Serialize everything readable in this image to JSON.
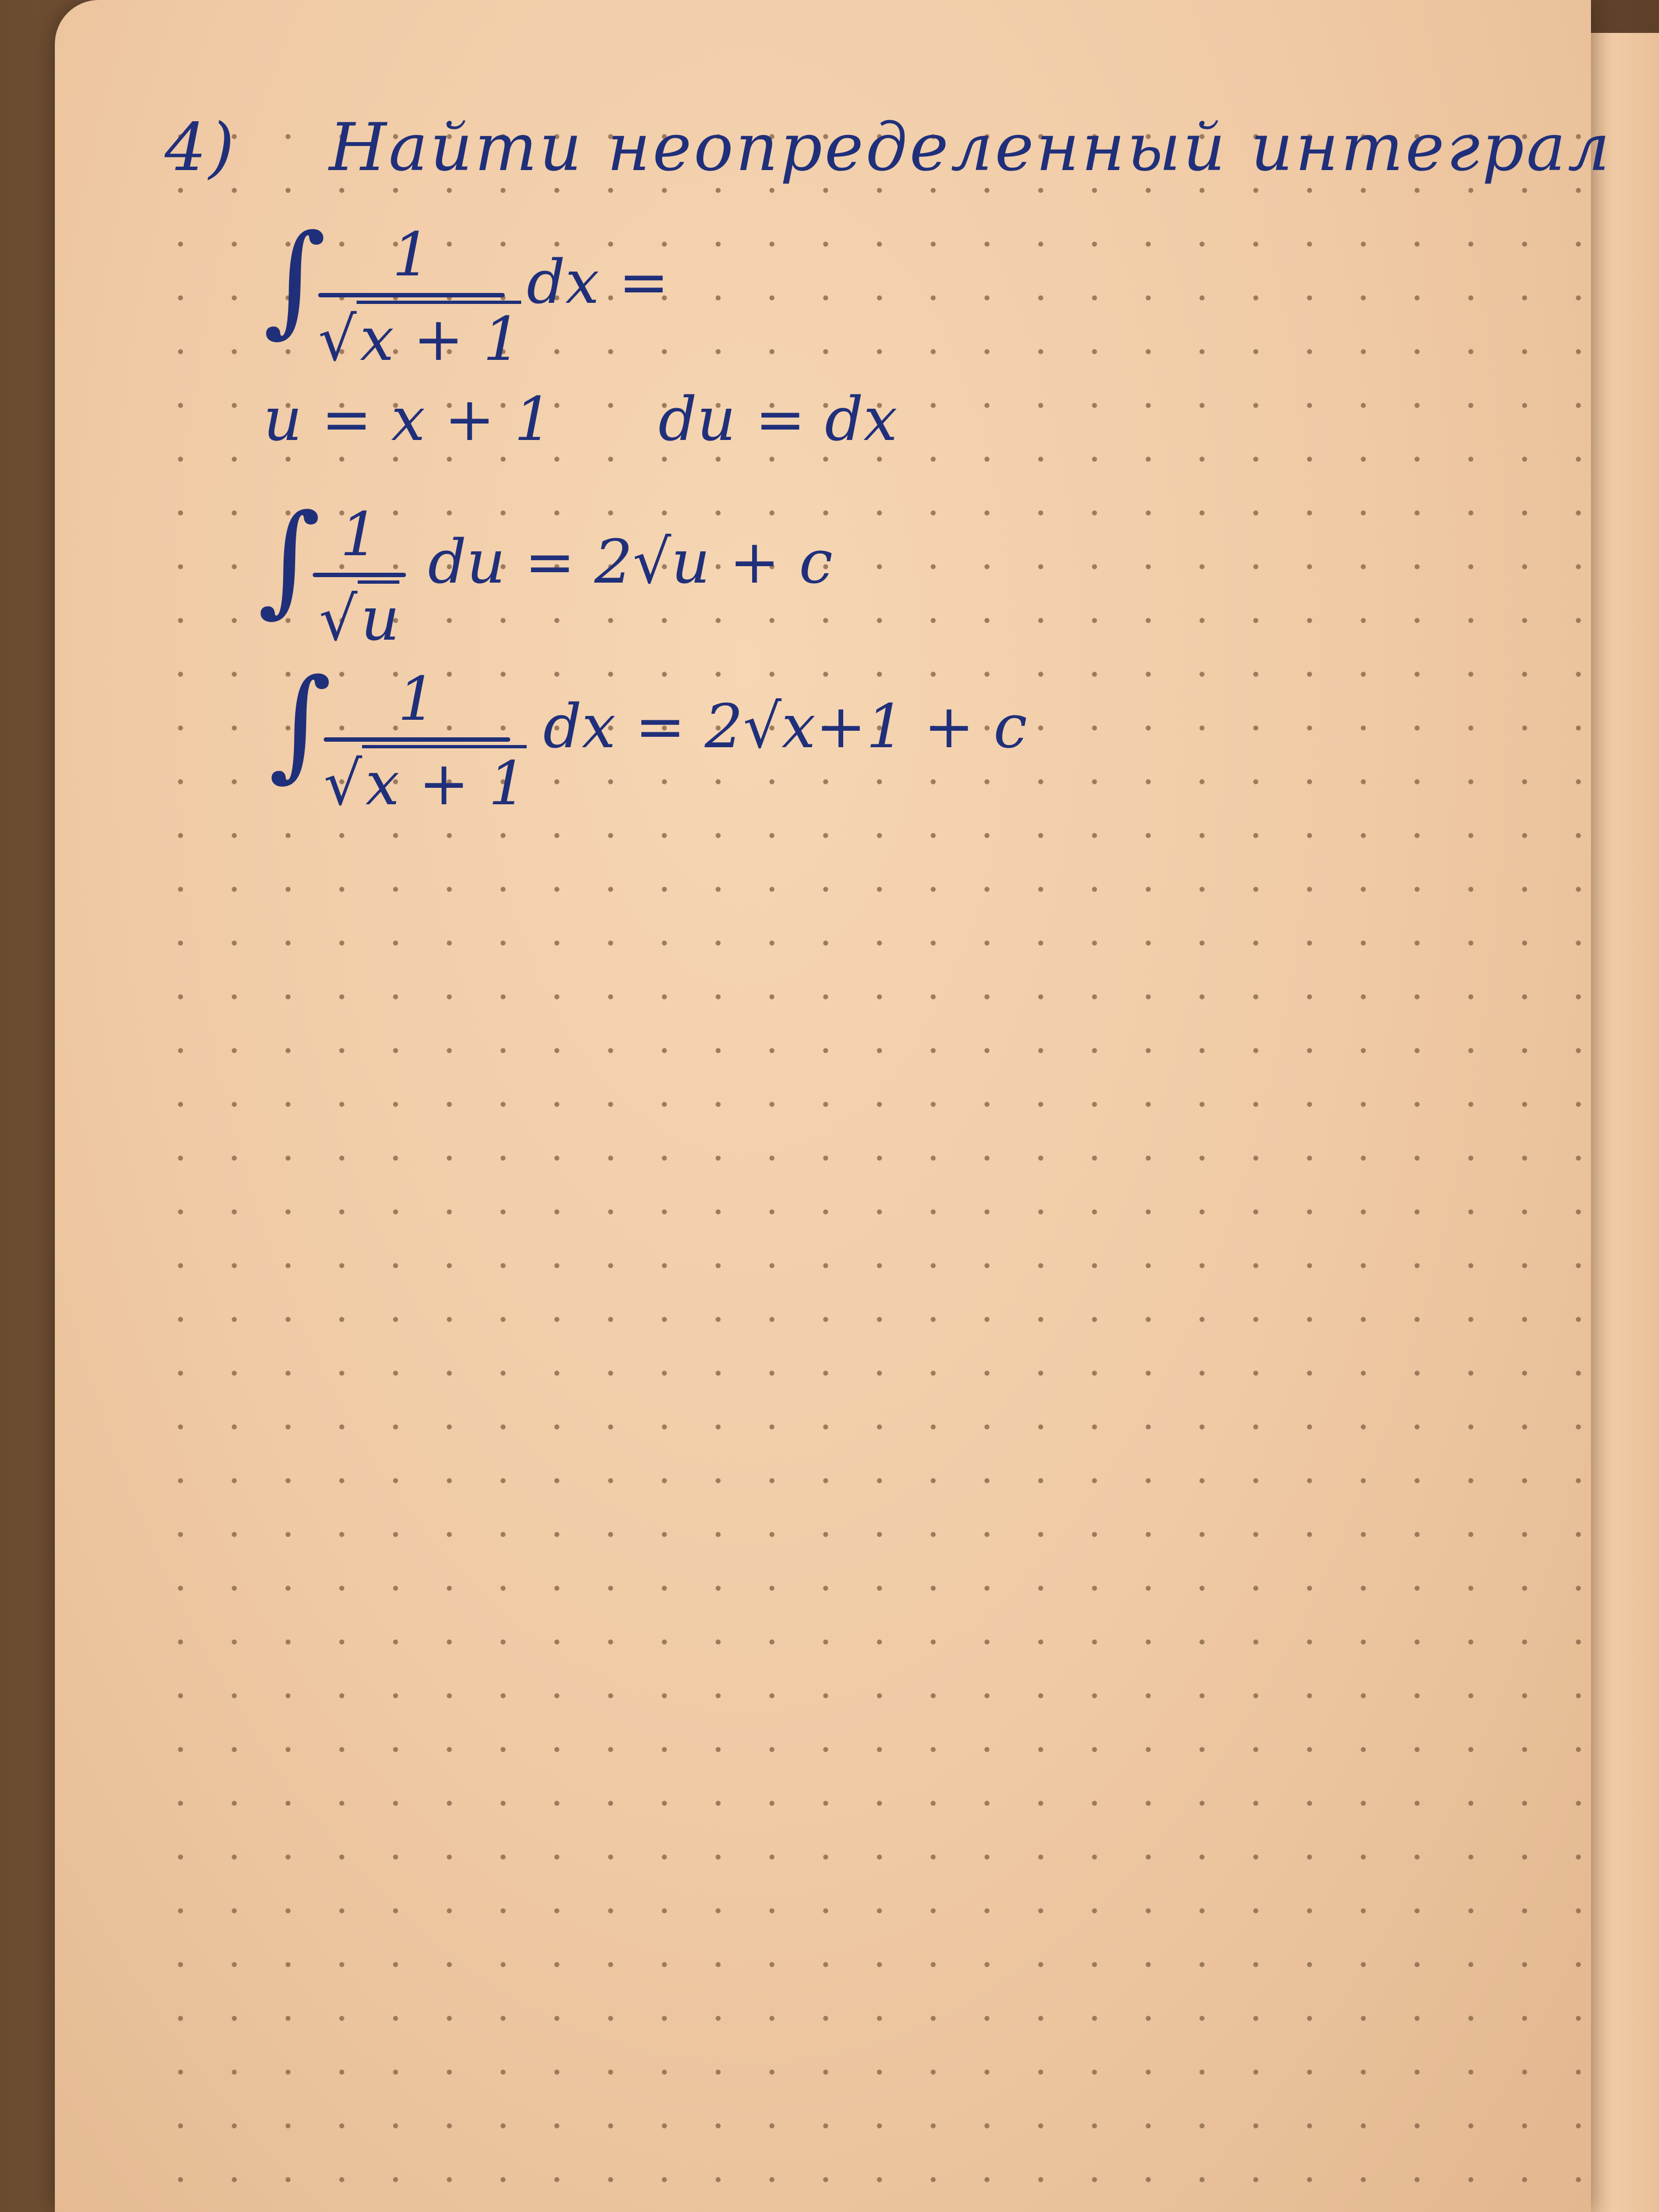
{
  "title": {
    "number": "4)",
    "text": "Найти неопределенный интеграл"
  },
  "line1": {
    "numerator": "1",
    "denominator": "x + 1",
    "tail": "dx ="
  },
  "line2": {
    "left": "u = x + 1",
    "right": "du = dx"
  },
  "line3": {
    "numerator": "1",
    "denominator": "u",
    "tail": "du = 2√u + c"
  },
  "line4": {
    "numerator": "1",
    "denominator": "x + 1",
    "tail": "dx = 2√x+1 + c"
  }
}
